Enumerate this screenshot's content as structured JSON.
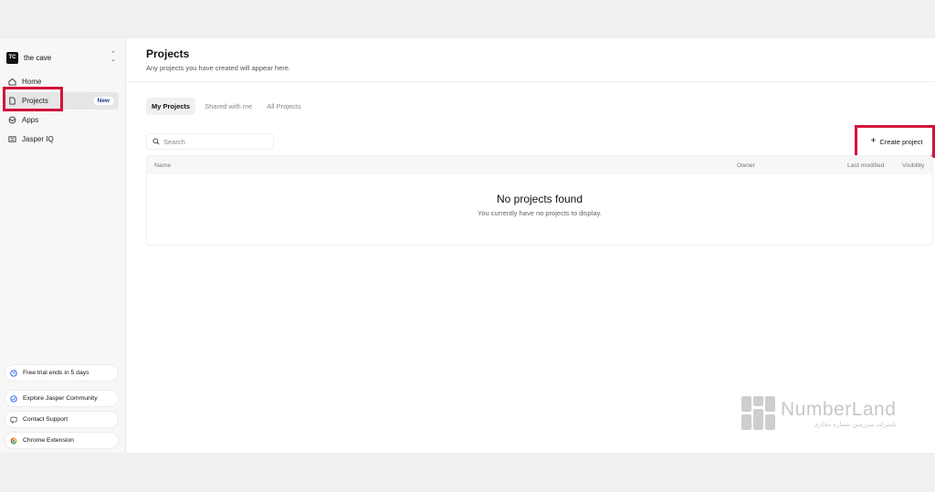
{
  "workspace": {
    "badge": "TC",
    "name": "the cave"
  },
  "sidebar": {
    "items": [
      {
        "label": "Home",
        "icon": "home-icon"
      },
      {
        "label": "Projects",
        "icon": "file-icon",
        "badge": "New",
        "active": true
      },
      {
        "label": "Apps",
        "icon": "grid-icon"
      },
      {
        "label": "Jasper IQ",
        "icon": "book-icon"
      }
    ],
    "footer": [
      {
        "label": "Free trial ends in 5 days",
        "icon": "clock-icon"
      },
      {
        "label": "Explore Jasper Community",
        "icon": "community-icon"
      },
      {
        "label": "Contact Support",
        "icon": "chat-icon"
      },
      {
        "label": "Chrome Extension",
        "icon": "chrome-icon"
      }
    ]
  },
  "header": {
    "title": "Projects",
    "subtitle": "Any projects you have created will appear here."
  },
  "tabs": [
    "My Projects",
    "Shared with me",
    "All Projects"
  ],
  "search": {
    "placeholder": "Search"
  },
  "create_button": {
    "label": "Create project"
  },
  "table": {
    "columns": [
      "Name",
      "Owner",
      "Last modified",
      "Visibility"
    ],
    "empty_title": "No projects found",
    "empty_subtitle": "You currently have no projects to display."
  },
  "watermark": {
    "name": "NumberLand",
    "tagline": "نامبرلند سرزمین شماره مجازی"
  },
  "colors": {
    "highlight": "#d4123a",
    "new_badge_text": "#1e3a8a"
  }
}
